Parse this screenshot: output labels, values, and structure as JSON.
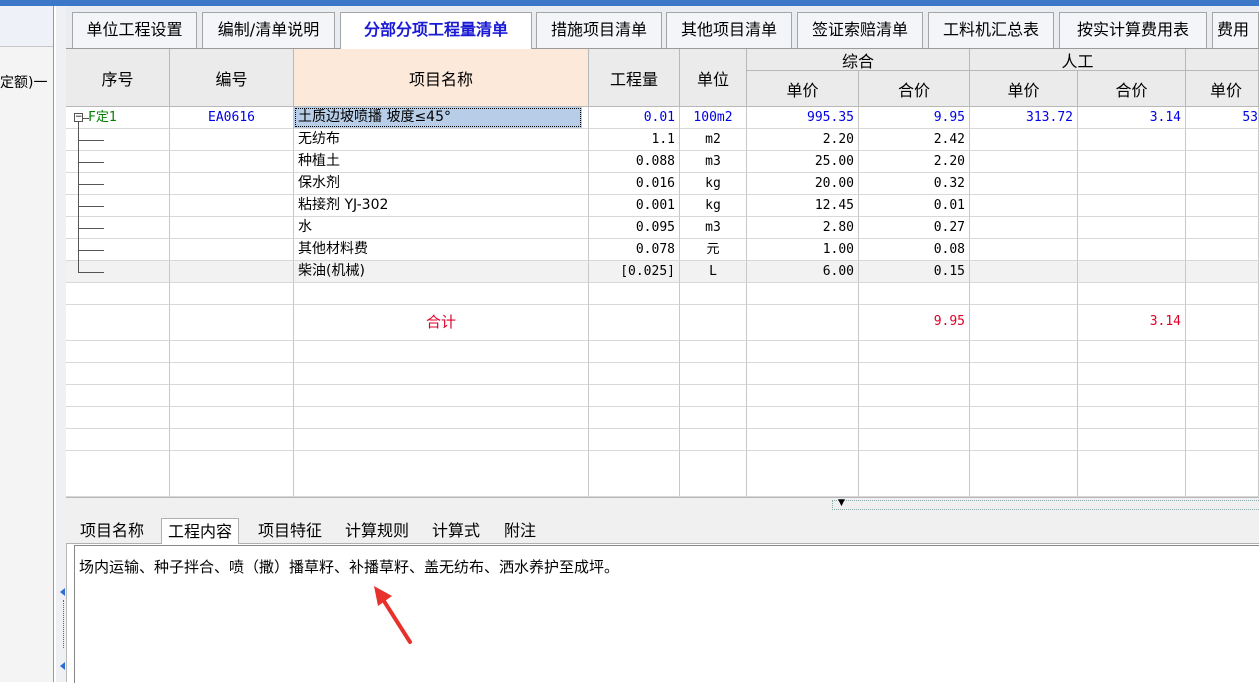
{
  "left_panel": {
    "text": "定额)一"
  },
  "tabs": [
    {
      "label": "单位工程设置",
      "active": false
    },
    {
      "label": "编制/清单说明",
      "active": false
    },
    {
      "label": "分部分项工程量清单",
      "active": true
    },
    {
      "label": "措施项目清单",
      "active": false
    },
    {
      "label": "其他项目清单",
      "active": false
    },
    {
      "label": "签证索赔清单",
      "active": false
    },
    {
      "label": "工料机汇总表",
      "active": false
    },
    {
      "label": "按实计算费用表",
      "active": false
    },
    {
      "label": "费用",
      "active": false
    }
  ],
  "table": {
    "headers": {
      "seq": "序号",
      "code": "编号",
      "name": "项目名称",
      "qty": "工程量",
      "unit": "单位",
      "composite": "综合",
      "labor": "人工",
      "unit_price": "单价",
      "total": "合价"
    },
    "rows": [
      {
        "seq": "F定1",
        "code": "EA0616",
        "name": "土质边坡喷播 坡度≤45°",
        "qty": "0.01",
        "unit": "100m2",
        "c_price": "995.35",
        "c_total": "9.95",
        "l_price": "313.72",
        "l_total": "3.14",
        "x_price": "53"
      },
      {
        "seq": "",
        "code": "",
        "name": "无纺布",
        "qty": "1.1",
        "unit": "m2",
        "c_price": "2.20",
        "c_total": "2.42",
        "l_price": "",
        "l_total": "",
        "x_price": ""
      },
      {
        "seq": "",
        "code": "",
        "name": "种植土",
        "qty": "0.088",
        "unit": "m3",
        "c_price": "25.00",
        "c_total": "2.20",
        "l_price": "",
        "l_total": "",
        "x_price": ""
      },
      {
        "seq": "",
        "code": "",
        "name": "保水剂",
        "qty": "0.016",
        "unit": "kg",
        "c_price": "20.00",
        "c_total": "0.32",
        "l_price": "",
        "l_total": "",
        "x_price": ""
      },
      {
        "seq": "",
        "code": "",
        "name": "粘接剂 YJ-302",
        "qty": "0.001",
        "unit": "kg",
        "c_price": "12.45",
        "c_total": "0.01",
        "l_price": "",
        "l_total": "",
        "x_price": ""
      },
      {
        "seq": "",
        "code": "",
        "name": "水",
        "qty": "0.095",
        "unit": "m3",
        "c_price": "2.80",
        "c_total": "0.27",
        "l_price": "",
        "l_total": "",
        "x_price": ""
      },
      {
        "seq": "",
        "code": "",
        "name": "其他材料费",
        "qty": "0.078",
        "unit": "元",
        "c_price": "1.00",
        "c_total": "0.08",
        "l_price": "",
        "l_total": "",
        "x_price": ""
      },
      {
        "seq": "",
        "code": "",
        "name": "柴油(机械)",
        "qty": "[0.025]",
        "unit": "L",
        "c_price": "6.00",
        "c_total": "0.15",
        "l_price": "",
        "l_total": "",
        "x_price": ""
      }
    ],
    "total_row": {
      "label": "合计",
      "c_total": "9.95",
      "l_total": "3.14"
    }
  },
  "bottom_tabs": [
    {
      "label": "项目名称",
      "active": false
    },
    {
      "label": "工程内容",
      "active": true
    },
    {
      "label": "项目特征",
      "active": false
    },
    {
      "label": "计算规则",
      "active": false
    },
    {
      "label": "计算式",
      "active": false
    },
    {
      "label": "附注",
      "active": false
    }
  ],
  "content_text": "场内运输、种子拌合、喷（撒）播草籽、补播草籽、盖无纺布、洒水养护至成坪。",
  "colors": {
    "accent": "#3c78c8",
    "active_tab_text": "#1a1ad6",
    "red": "#e0002a",
    "blue": "#0000e6",
    "green": "#008000",
    "annotation_arrow": "#e8312a"
  }
}
